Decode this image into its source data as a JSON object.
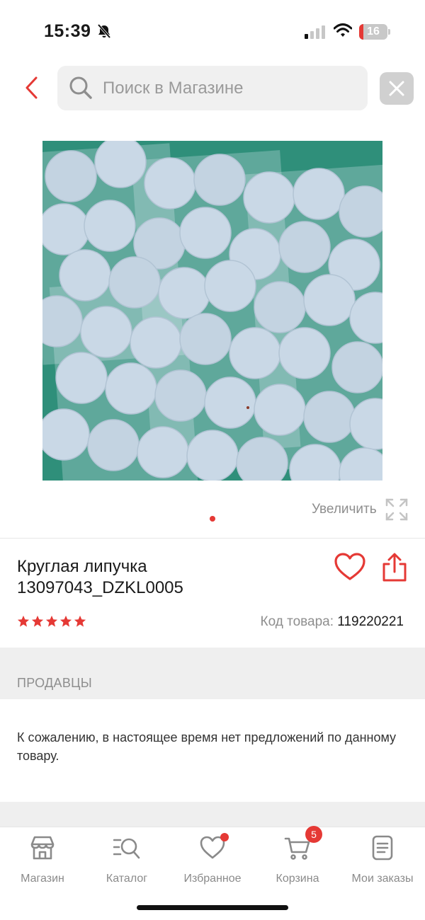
{
  "status_bar": {
    "time": "15:39",
    "battery_level": "16",
    "battery_fraction": 0.16
  },
  "search": {
    "placeholder": "Поиск в Магазине",
    "value": ""
  },
  "product": {
    "zoom_label": "Увеличить",
    "title_line1": "Круглая липучка",
    "title_line2": "13097043_DZKL0005",
    "rating": 5,
    "rating_max": 5,
    "code_label": "Код товара:",
    "code_value": "119220221",
    "image_count": 1,
    "active_image": 1
  },
  "sellers": {
    "header": "ПРОДАВЦЫ",
    "message": "К сожалению, в настоящее время нет предложений по данному товару."
  },
  "tab_bar": {
    "items": [
      {
        "label": "Магазин",
        "icon": "store-icon"
      },
      {
        "label": "Каталог",
        "icon": "catalog-search-icon"
      },
      {
        "label": "Избранное",
        "icon": "heart-icon",
        "has_dot": true
      },
      {
        "label": "Корзина",
        "icon": "cart-icon",
        "badge": "5"
      },
      {
        "label": "Мои заказы",
        "icon": "orders-icon"
      }
    ]
  },
  "colors": {
    "accent": "#e53935",
    "image_background": "#2f8f7a",
    "velcro_dot": "#c9d8e6",
    "muted_text": "#8e8e8e"
  }
}
